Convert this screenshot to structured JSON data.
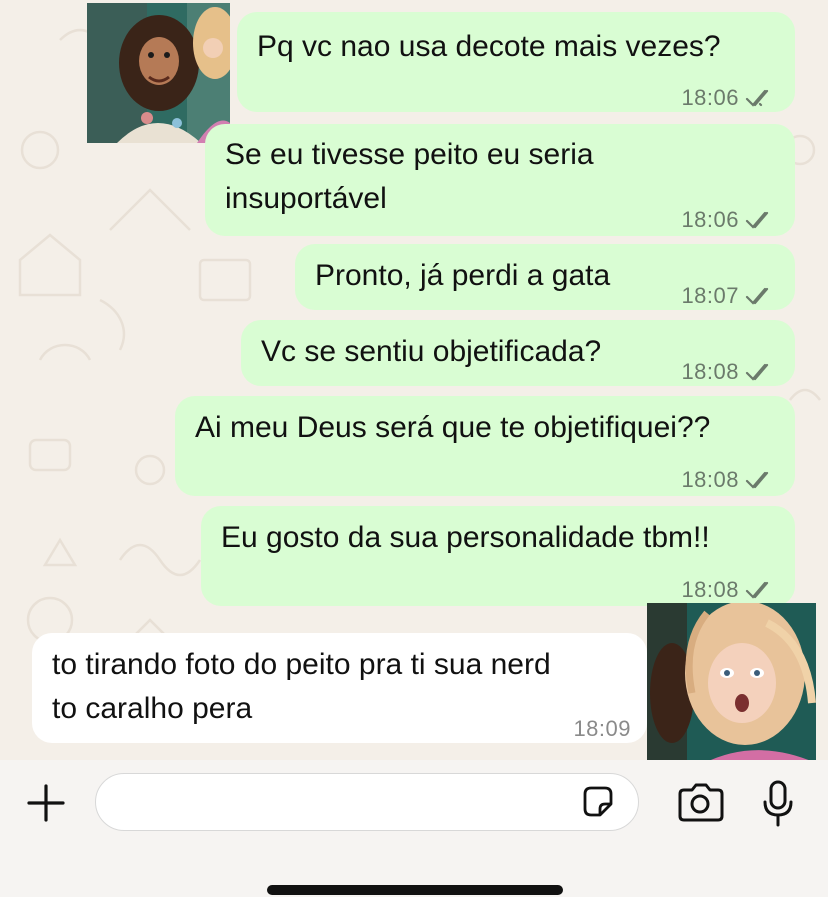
{
  "chat": {
    "messages": [
      {
        "direction": "outgoing",
        "lines": [
          "Pq vc nao usa decote mais vezes?"
        ],
        "time": "18:06",
        "status": "read"
      },
      {
        "direction": "outgoing",
        "lines": [
          "Se eu tivesse peito eu seria",
          "insuportável"
        ],
        "time": "18:06",
        "status": "read"
      },
      {
        "direction": "outgoing",
        "lines": [
          "Pronto, já perdi a gata"
        ],
        "time": "18:07",
        "status": "read"
      },
      {
        "direction": "outgoing",
        "lines": [
          "Vc se sentiu objetificada?"
        ],
        "time": "18:08",
        "status": "read"
      },
      {
        "direction": "outgoing",
        "lines": [
          "Ai meu Deus será que te objetifiquei??"
        ],
        "time": "18:08",
        "status": "read"
      },
      {
        "direction": "outgoing",
        "lines": [
          "Eu gosto da sua personalidade tbm!!"
        ],
        "time": "18:08",
        "status": "read"
      },
      {
        "direction": "incoming",
        "lines": [
          "to tirando foto do peito pra ti sua nerd",
          "to caralho pera"
        ],
        "time": "18:09"
      }
    ]
  },
  "input_bar": {
    "icons": [
      "plus-icon",
      "sticker-icon",
      "camera-icon",
      "microphone-icon"
    ]
  },
  "colors": {
    "outgoing_bubble": "#d9fdd3",
    "incoming_bubble": "#ffffff",
    "chat_background": "#f4efe8",
    "read_ticks": "#6b7a6b"
  }
}
